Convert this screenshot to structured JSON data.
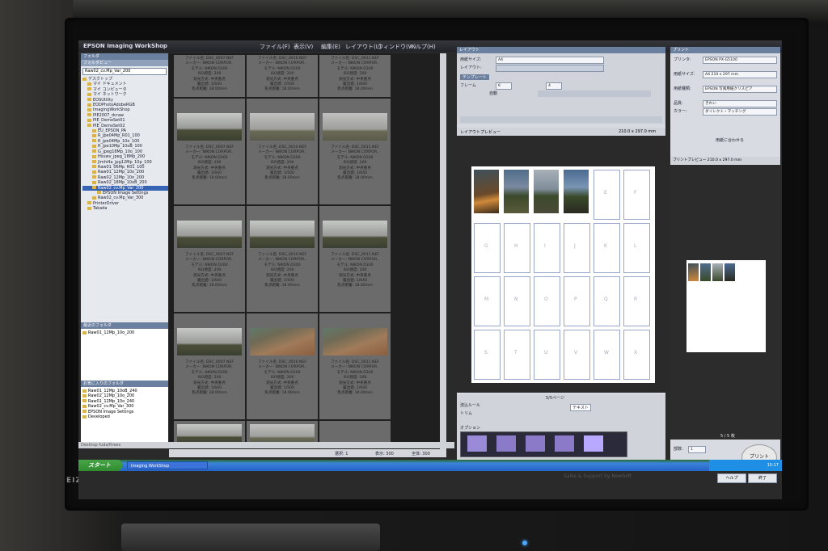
{
  "app": {
    "title": "EPSON Imaging WorkShop",
    "menu": [
      "ファイル(F)",
      "表示(V)",
      "編集(E)",
      "レイアウト(L)",
      "ウィンドウ(W)",
      "ヘルプ(H)"
    ]
  },
  "left_panel": {
    "folders_header": "フォルダ",
    "folder_view": "フォルダビュー",
    "current_folder": "Raw02_cv.Mp_Var_200",
    "tree": [
      "デスクトップ",
      "マイ ドキュメント",
      "マイ コンピュータ",
      "マイ ネットワーク",
      "EOSUtility",
      "EODPhotoAdobeRGB",
      "ImagingWorkShop",
      "PIE2007_dcraw",
      "PIE_DemoSet01",
      "PIE_DemoSet02",
      "EU_EPSON_PA",
      "R_jpe04Mp_R01_100",
      "R_jpe04Mp_10o_100",
      "R_jpe10Mp_10oB_100",
      "G_jpeg18Mp_10o_100",
      "Hsuwv_jpeg_18Mp_200",
      "Jimhi4a_jpg12Mp_10p_100",
      "Raw01_06Mp_R01_100",
      "Raw01_12Mp_10o_200",
      "Raw02_12Mp_10o_200",
      "Raw02_18Mp_10oB_200",
      "Raw02_cv.Mp_Var_200",
      "EPSON Image Settings",
      "Raw02_cv.Mp_Var_300",
      "PrinterDriver",
      "Takada"
    ],
    "recent_header": "最近のフォルダ",
    "recent": [
      "Raw01_12Mp_10o_200"
    ],
    "favorites_header": "お気に入りのフォルダ",
    "favorites": [
      "Raw01_12Mp_10oB_240",
      "Raw02_12Mp_10o_200",
      "Raw01_12Mp_10o_240",
      "Raw02_cv.Mp_Var_300",
      "EPSON Image Settings",
      "Developed"
    ],
    "status": "Desktop fuda/Rrees"
  },
  "thumbnails": {
    "captions": [
      "ファイル名: DSC_0007.NEF\nメーカー: NIKON CORPOR..\nモデル: NIKON D300\nISO感度: 200\n測光方式: 中央重点\n露出値: 1/640\n焦点距離: 18.00mm",
      "ファイル名: DSC_0010.NEF\nメーカー: NIKON CORPOR..\nモデル: NIKON D300\nISO感度: 200\n測光方式: 中央重点\n露出値: 1/500\n焦点距離: 18.00mm",
      "ファイル名: DSC_0011.NEF\nメーカー: NIKON CORPOR..\nモデル: NIKON D300\nISO感度: 200\n測光方式: 中央重点\n露出値: 1/640\n焦点距離: 18.00mm"
    ],
    "status_left": "選択: 1",
    "status_mid": "表示: 300",
    "status_right": "全体: 300"
  },
  "layout_panel": {
    "header": "レイアウト",
    "paper_size_label": "用紙サイズ:",
    "paper_size": "A4",
    "layout_label": "レイアウト:",
    "template_label": "テンプレート",
    "frame_label": "フレーム",
    "auto_label": "自動",
    "frame_count": "6",
    "frame_count2": "4",
    "preview_label": "レイアウトプレビュー",
    "preview_size": "210.0 x 297.0 mm",
    "slots": [
      "E",
      "F",
      "G",
      "H",
      "I",
      "J",
      "K",
      "L",
      "M",
      "N",
      "O",
      "P",
      "Q",
      "R",
      "S",
      "T",
      "U",
      "V",
      "W",
      "X"
    ],
    "page_indicator": "5/5ページ",
    "auto_label2": "流込ルール",
    "trim_label": "トリム",
    "option_label": "オプション",
    "text_label": "テキスト"
  },
  "print_panel": {
    "header": "プリント",
    "printer_label": "プリンタ:",
    "printer": "EPSON PX-G5100",
    "paper_label": "用紙サイズ:",
    "paper": "A4 210 x 297 mm",
    "media_label": "用紙種類:",
    "media": "EPSON 写真用紙クリスピア",
    "quality_label": "品質:",
    "quality": "きれい",
    "color_label": "カラー:",
    "color": "ダイレクト・マッチング",
    "fit_label": "用紙に合わせる",
    "preview_label": "プリントプレビュー 210.0 x 297.0 mm",
    "page_indicator": "5 / 5 枚",
    "copies_label": "部数:",
    "copies": "1",
    "print_button": "プリント"
  },
  "taskbar": {
    "start": "スタート",
    "item": "Imaging WorkShop",
    "clock": "15:17"
  },
  "footer": {
    "sales": "Sales & Support by NewSoft",
    "help": "ヘルプ",
    "exit": "終了"
  },
  "monitor": {
    "brand": "EIZO"
  }
}
